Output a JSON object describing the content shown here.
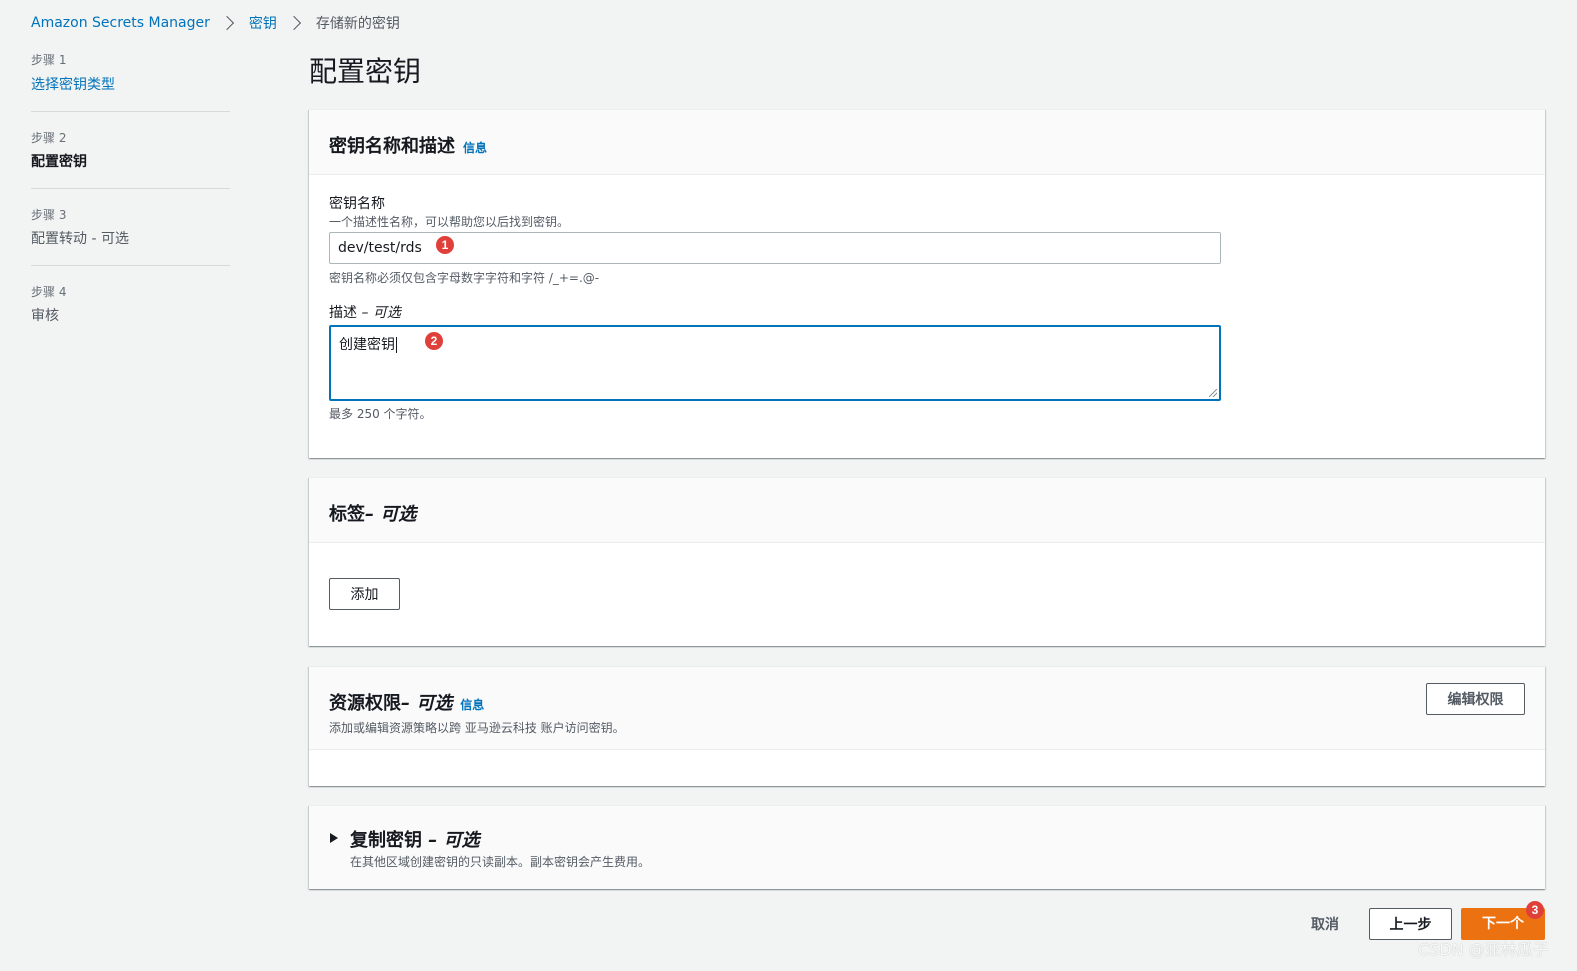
{
  "breadcrumb": {
    "items": [
      "Amazon Secrets Manager",
      "密钥",
      "存储新的密钥"
    ]
  },
  "steps": [
    {
      "number": "步骤 1",
      "label": "选择密钥类型",
      "state": "link"
    },
    {
      "number": "步骤 2",
      "label": "配置密钥",
      "state": "active"
    },
    {
      "number": "步骤 3",
      "label": "配置转动 - 可选",
      "state": "default"
    },
    {
      "number": "步骤 4",
      "label": "审核",
      "state": "default"
    }
  ],
  "page_title": "配置密钥",
  "name_panel": {
    "title": "密钥名称和描述",
    "info": "信息",
    "name_label": "密钥名称",
    "name_desc": "一个描述性名称，可以帮助您以后找到密钥。",
    "name_value": "dev/test/rds",
    "name_constraint": "密钥名称必须仅包含字母数字字符和字符 /_+=.@-",
    "desc_label": "描述",
    "desc_optional": " – 可选",
    "desc_value": "创建密钥",
    "desc_constraint": "最多 250 个字符。"
  },
  "tags_panel": {
    "title": "标签",
    "optional": " – 可选",
    "add_button": "添加"
  },
  "perm_panel": {
    "title": "资源权限",
    "optional": " – 可选",
    "info": "信息",
    "subtitle": "添加或编辑资源策略以跨 亚马逊云科技 账户访问密钥。",
    "edit_button": "编辑权限"
  },
  "rep_panel": {
    "title": "复制密钥",
    "optional": " – 可选",
    "subtitle": "在其他区域创建密钥的只读副本。副本密钥会产生费用。"
  },
  "footer": {
    "cancel": "取消",
    "previous": "上一步",
    "next": "下一个"
  },
  "badges": [
    "1",
    "2",
    "3"
  ],
  "watermark": "CSDN @亚林瓜子",
  "colors": {
    "link": "#0073bb",
    "primary": "#ec7211",
    "badge": "#e0403a",
    "focus": "#0073bb"
  }
}
